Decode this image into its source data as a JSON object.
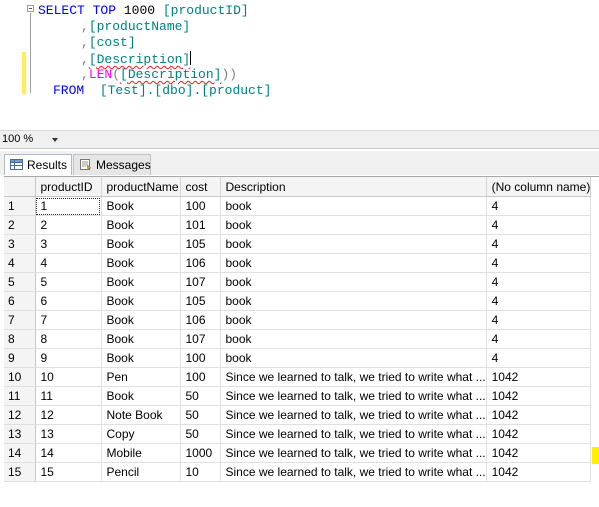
{
  "editor": {
    "line1": {
      "select": "SELECT",
      "top": "TOP",
      "num": "1000",
      "col": "[productID]"
    },
    "line2": {
      "comma": ",",
      "col": "[productName]"
    },
    "line3": {
      "comma": ",",
      "col": "[cost]"
    },
    "line4": {
      "comma": ",",
      "col": "[Description]"
    },
    "line5": {
      "comma": ",",
      "fn": "LEN",
      "open": "(",
      "col": "[Description]",
      "close": "))"
    },
    "line6": {
      "from": "FROM",
      "table": "[Test].[dbo].[product]"
    }
  },
  "zoom": {
    "value": "100 %"
  },
  "tabs": {
    "results": "Results",
    "messages": "Messages"
  },
  "grid": {
    "columns": [
      "productID",
      "productName",
      "cost",
      "Description",
      "(No column name)"
    ],
    "rows": [
      {
        "n": "1",
        "cells": [
          "1",
          "Book",
          "100",
          "book",
          "4"
        ]
      },
      {
        "n": "2",
        "cells": [
          "2",
          "Book",
          "101",
          "book",
          "4"
        ]
      },
      {
        "n": "3",
        "cells": [
          "3",
          "Book",
          "105",
          "book",
          "4"
        ]
      },
      {
        "n": "4",
        "cells": [
          "4",
          "Book",
          "106",
          "book",
          "4"
        ]
      },
      {
        "n": "5",
        "cells": [
          "5",
          "Book",
          "107",
          "book",
          "4"
        ]
      },
      {
        "n": "6",
        "cells": [
          "6",
          "Book",
          "105",
          "book",
          "4"
        ]
      },
      {
        "n": "7",
        "cells": [
          "7",
          "Book",
          "106",
          "book",
          "4"
        ]
      },
      {
        "n": "8",
        "cells": [
          "8",
          "Book",
          "107",
          "book",
          "4"
        ]
      },
      {
        "n": "9",
        "cells": [
          "9",
          "Book",
          "100",
          "book",
          "4"
        ]
      },
      {
        "n": "10",
        "cells": [
          "10",
          "Pen",
          "100",
          "Since we learned to talk, we tried to write what ...",
          "1042"
        ]
      },
      {
        "n": "11",
        "cells": [
          "11",
          "Book",
          "50",
          "Since we learned to talk, we tried to write what ...",
          "1042"
        ]
      },
      {
        "n": "12",
        "cells": [
          "12",
          "Note Book",
          "50",
          "Since we learned to talk, we tried to write what ...",
          "1042"
        ]
      },
      {
        "n": "13",
        "cells": [
          "13",
          "Copy",
          "50",
          "Since we learned to talk, we tried to write what ...",
          "1042"
        ]
      },
      {
        "n": "14",
        "cells": [
          "14",
          "Mobile",
          "1000",
          "Since we learned to talk, we tried to write what ...",
          "1042"
        ]
      },
      {
        "n": "15",
        "cells": [
          "15",
          "Pencil",
          "10",
          "Since we learned to talk, we tried to write what ...",
          "1042"
        ]
      }
    ]
  },
  "colors": {
    "keyword": "#0000ff",
    "object": "#008080",
    "function": "#ff00ff",
    "operator": "#808080",
    "highlight": "#ffee00"
  },
  "icons": {
    "results_tab": "grid-icon",
    "messages_tab": "messages-icon",
    "zoom": "chevron-down-icon"
  }
}
